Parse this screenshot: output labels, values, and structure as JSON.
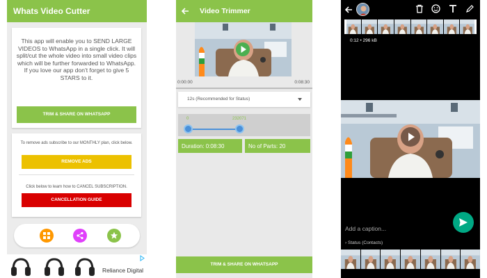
{
  "screen1": {
    "title": "Whats Video Cutter",
    "intro_text": "This app will enable you to SEND LARGE VIDEOS to WhatsApp in a single click. It will split/cut the whole video into small video clips which will be further forwarded to WhatsApp. If you love our app don't forget to give 5 STARS to it.",
    "trim_share_label": "TRIM & SHARE ON WHATSAPP",
    "remove_ads_note": "To remove ads subscribe to our MONTHLY plan, click below.",
    "remove_ads_label": "REMOVE ADS",
    "cancel_note": "Click below to learn how to CANCEL SUBSCRIPTION.",
    "cancel_label": "CANCELLATION GUIDE",
    "ad_brand": "Reliance Digital",
    "colors": {
      "appbar": "#8bc34a",
      "remove_ads": "#ecc100",
      "cancel": "#d90000",
      "apps_icon": "#ff9800",
      "share_icon": "#e040fb",
      "star_icon": "#8bc34a"
    },
    "icons": [
      "apps-icon",
      "share-icon",
      "star-icon"
    ]
  },
  "screen2": {
    "title": "Video Trimmer",
    "start_time": "0:00:00",
    "end_time": "0:08:30",
    "seek_start_time": "0:00:00",
    "seek_end_time": "0:08:30",
    "dropdown_value": "12s (Recommended for Status)",
    "range_min_label": "0",
    "range_max_label": "232071",
    "duration_label": "Duration:",
    "duration_value": "0:08:30",
    "parts_label": "No of Parts:",
    "parts_value": "20",
    "bottom_button": "TRIM & SHARE ON WHATSAPP"
  },
  "screen3": {
    "video_info": "0:12 • 296 kB",
    "caption_placeholder": "Add a caption...",
    "status_label": "Status (Contacts)",
    "colors": {
      "send": "#00a884"
    },
    "icons": [
      "back-arrow-icon",
      "delete-icon",
      "emoji-icon",
      "text-icon",
      "pencil-icon",
      "play-icon",
      "send-icon",
      "chevron-right-icon"
    ]
  }
}
